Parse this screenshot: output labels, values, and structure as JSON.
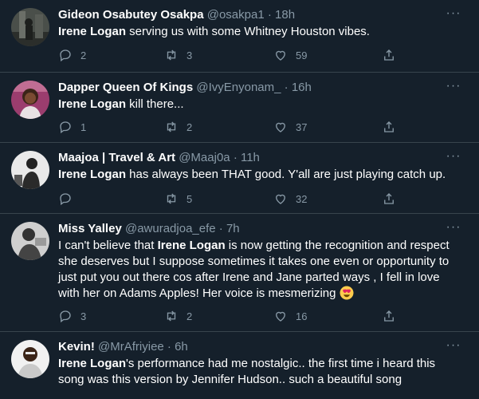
{
  "tweets": [
    {
      "name": "Gideon Osabutey Osakpa",
      "handle": "@osakpa1",
      "time": "18h",
      "highlight": "Irene Logan",
      "text": " serving us with some Whitney Houston vibes.",
      "replies": "2",
      "retweets": "3",
      "likes": "59"
    },
    {
      "name": "Dapper Queen Of Kings",
      "handle": "@IvyEnyonam_",
      "time": "16h",
      "highlight": "Irene Logan",
      "text": " kill there...",
      "replies": "1",
      "retweets": "2",
      "likes": "37"
    },
    {
      "name": "Maajoa | Travel & Art",
      "handle": "@Maaj0a",
      "time": "11h",
      "highlight": "Irene Logan",
      "text": " has always been THAT good. Y'all are just playing catch up.",
      "replies": "",
      "retweets": "5",
      "likes": "32"
    },
    {
      "name": "Miss Yalley",
      "handle": "@awuradjoa_efe",
      "time": "7h",
      "text_before": "I can't believe that ",
      "highlight": "Irene Logan",
      "text": " is now getting the recognition and respect she deserves but I suppose sometimes it takes one even or opportunity to just put you out there cos after Irene and Jane parted ways , I fell in love with her on  Adams Apples! Her voice is mesmerizing ",
      "replies": "3",
      "retweets": "2",
      "likes": "16"
    },
    {
      "name": "Kevin!",
      "handle": "@MrAfriyiee",
      "time": "6h",
      "highlight": "Irene Logan",
      "text": "'s performance had me nostalgic.. the first time i heard this song was this version by Jennifer Hudson.. such a beautiful song"
    }
  ],
  "separator": "·",
  "colors": {
    "background": "#15202b",
    "divider": "#38444d",
    "muted": "#8899a6",
    "text": "#ffffff"
  }
}
